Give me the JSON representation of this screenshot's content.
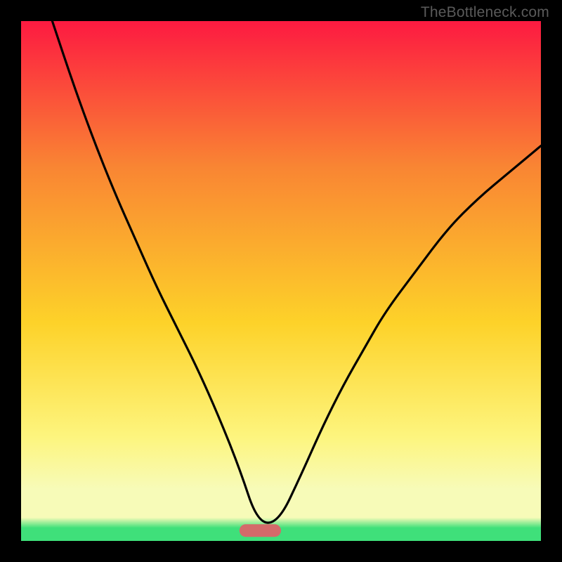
{
  "watermark": "TheBottleneck.com",
  "chart_data": {
    "type": "line",
    "title": "",
    "xlabel": "",
    "ylabel": "",
    "xlim": [
      0,
      100
    ],
    "ylim": [
      0,
      100
    ],
    "grid": false,
    "background_gradient": {
      "top": "#fd1a41",
      "upper_mid": "#f98533",
      "mid": "#fdd229",
      "lower_mid": "#fdf57e",
      "band": "#f7fbb8",
      "bottom": "#3fe07a"
    },
    "baseline_marker": {
      "x_range": [
        42,
        50
      ],
      "y": 2,
      "color": "#d46a6a"
    },
    "series": [
      {
        "name": "bottleneck-curve",
        "x": [
          6,
          10,
          14,
          18,
          22,
          26,
          30,
          34,
          38,
          42,
          45.5,
          49.5,
          54,
          58,
          62,
          66,
          70,
          76,
          82,
          88,
          94,
          100
        ],
        "y": [
          100,
          88,
          77,
          67,
          58,
          49,
          41,
          33,
          24,
          14,
          3.5,
          3.5,
          13,
          22,
          30,
          37,
          44,
          52,
          60,
          66,
          71,
          76
        ]
      }
    ]
  }
}
